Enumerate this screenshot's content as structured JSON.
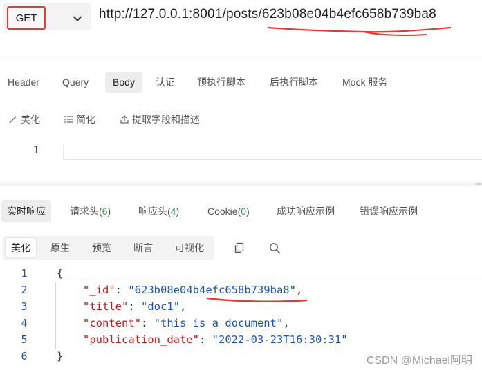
{
  "request": {
    "method": "GET",
    "url": "http://127.0.0.1:8001/posts/623b08e04b4efc658b739ba8"
  },
  "request_tabs": [
    {
      "label": "Header"
    },
    {
      "label": "Query"
    },
    {
      "label": "Body"
    },
    {
      "label": "认证"
    },
    {
      "label": "预执行脚本"
    },
    {
      "label": "后执行脚本"
    },
    {
      "label": "Mock 服务"
    }
  ],
  "body_tools": {
    "beautify": "美化",
    "simplify": "简化",
    "extract": "提取字段和描述"
  },
  "body_editor": {
    "line_number": "1"
  },
  "response_tabs": {
    "realtime": "实时响应",
    "req_headers": "请求头",
    "req_headers_count": "6",
    "resp_headers": "响应头",
    "resp_headers_count": "4",
    "cookie": "Cookie",
    "cookie_count": "0",
    "success_example": "成功响应示例",
    "error_example": "错误响应示例"
  },
  "view_options": [
    {
      "label": "美化"
    },
    {
      "label": "原生"
    },
    {
      "label": "预览"
    },
    {
      "label": "断言"
    },
    {
      "label": "可视化"
    }
  ],
  "response_json": {
    "line_numbers": [
      "1",
      "2",
      "3",
      "4",
      "5",
      "6"
    ],
    "open_brace": "{",
    "close_brace": "}",
    "fields": [
      {
        "key": "\"_id\"",
        "value": "\"623b08e04b4efc658b739ba8\"",
        "comma": ","
      },
      {
        "key": "\"title\"",
        "value": "\"doc1\"",
        "comma": ","
      },
      {
        "key": "\"content\"",
        "value": "\"this is a document\"",
        "comma": ","
      },
      {
        "key": "\"publication_date\"",
        "value": "\"2022-03-23T16:30:31\"",
        "comma": ""
      }
    ]
  },
  "watermark": "CSDN @Michael阿明",
  "colors": {
    "annotation_red": "#e53935",
    "key_red": "#c41a16",
    "string_blue": "#1a55b5",
    "count_green": "#2e9c4c"
  },
  "icons": [
    "chevron-down-icon",
    "magic-wand-icon",
    "list-icon",
    "extract-icon",
    "copy-icon",
    "search-icon"
  ]
}
